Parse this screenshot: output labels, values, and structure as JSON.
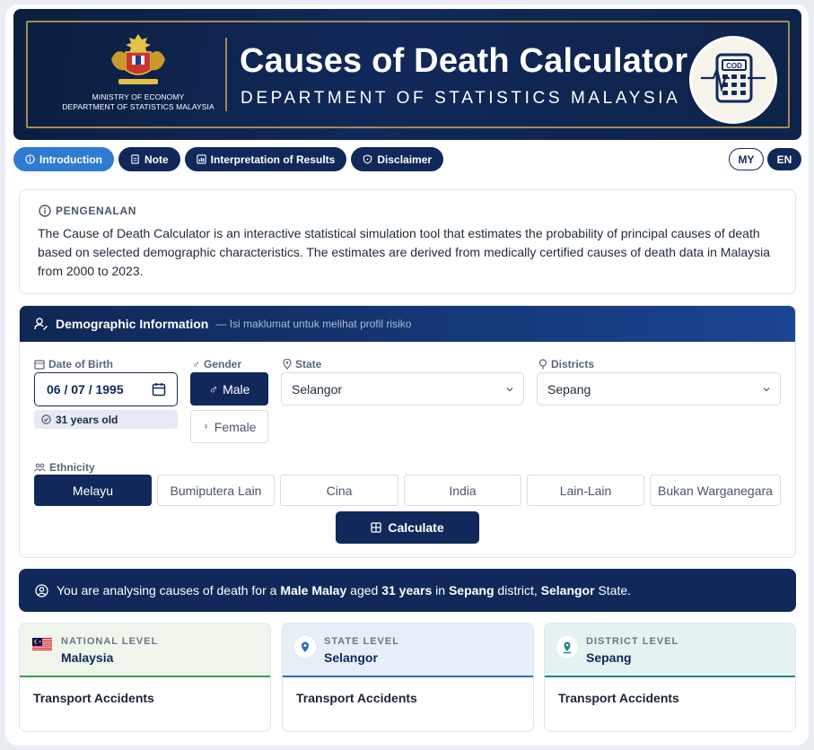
{
  "header": {
    "ministry_line1": "MINISTRY OF ECONOMY",
    "ministry_line2": "DEPARTMENT OF STATISTICS MALAYSIA",
    "title": "Causes of Death Calculator",
    "subtitle": "DEPARTMENT OF STATISTICS MALAYSIA",
    "badge_text": "COD",
    "crest_icon": "malaysia-coat-of-arms",
    "calculator_icon": "calculator-heartbeat-icon",
    "navy": "#10295a",
    "gold": "#a58c52"
  },
  "tabs": [
    {
      "label": "Introduction",
      "icon": "info-icon",
      "active": true
    },
    {
      "label": "Note",
      "icon": "document-icon",
      "active": false
    },
    {
      "label": "Interpretation of Results",
      "icon": "chart-icon",
      "active": false
    },
    {
      "label": "Disclaimer",
      "icon": "shield-icon",
      "active": false
    }
  ],
  "language": {
    "my": "MY",
    "en": "EN",
    "selected": "EN"
  },
  "intro": {
    "heading": "PENGENALAN",
    "text": "The Cause of Death Calculator is an interactive statistical simulation tool that estimates the probability of principal causes of death based on selected demographic characteristics. The estimates are derived from medically certified causes of death data in Malaysia from 2000 to 2023."
  },
  "demographic": {
    "title": "Demographic Information",
    "hint": "— Isi maklumat untuk melihat profil risiko",
    "dob_label": "Date of Birth",
    "dob_value": "06 / 07 / 1995",
    "age_text": "31 years old",
    "gender_label": "Gender",
    "gender_male": "Male",
    "gender_female": "Female",
    "gender_selected": "Male",
    "state_label": "State",
    "state_value": "Selangor",
    "district_label": "Districts",
    "district_value": "Sepang",
    "ethnicity_label": "Ethnicity",
    "ethnicities": [
      "Melayu",
      "Bumiputera Lain",
      "Cina",
      "India",
      "Lain-Lain",
      "Bukan Warganegara"
    ],
    "ethnicity_selected": "Melayu",
    "calculate_label": "Calculate"
  },
  "summary": {
    "t1": "You are analysing causes of death for a",
    "gender_eth": "Male Malay",
    "t2": "aged",
    "age": "31 years",
    "t3": "in",
    "district": "Sepang",
    "t4": "district,",
    "state": "Selangor",
    "t5": "State."
  },
  "levels": [
    {
      "kicker": "NATIONAL LEVEL",
      "name": "Malaysia",
      "result": "Transport Accidents",
      "icon": "malaysia-flag-icon",
      "tint": "#eef6ec",
      "accent": "#3f9b4a"
    },
    {
      "kicker": "STATE LEVEL",
      "name": "Selangor",
      "result": "Transport Accidents",
      "icon": "location-pin-icon",
      "tint": "#e7eef8",
      "accent": "#2a6bbd"
    },
    {
      "kicker": "DISTRICT LEVEL",
      "name": "Sepang",
      "result": "Transport Accidents",
      "icon": "map-pin-icon",
      "tint": "#e4f3f1",
      "accent": "#1f8a7a"
    }
  ]
}
